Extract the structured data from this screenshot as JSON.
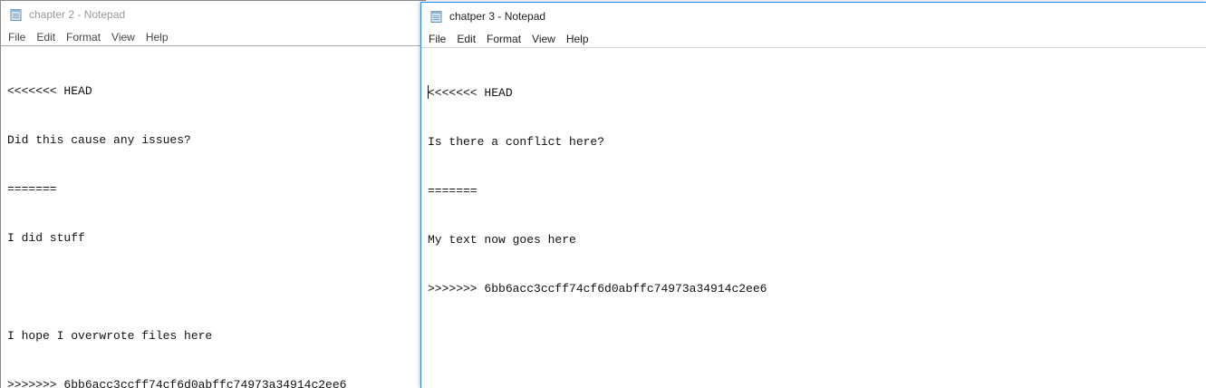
{
  "windows": [
    {
      "title": "chapter 2 - Notepad",
      "active": false,
      "icon": "notepad-icon",
      "menu": [
        "File",
        "Edit",
        "Format",
        "View",
        "Help"
      ],
      "lines": [
        "<<<<<<< HEAD",
        "Did this cause any issues?",
        "=======",
        "I did stuff",
        "",
        "I hope I overwrote files here",
        ">>>>>>> 6bb6acc3ccff74cf6d0abffc74973a34914c2ee6"
      ]
    },
    {
      "title": "chatper 3 - Notepad",
      "active": true,
      "icon": "notepad-icon",
      "menu": [
        "File",
        "Edit",
        "Format",
        "View",
        "Help"
      ],
      "lines": [
        "<<<<<<< HEAD",
        "Is there a conflict here?",
        "=======",
        "My text now goes here",
        ">>>>>>> 6bb6acc3ccff74cf6d0abffc74973a34914c2ee6"
      ]
    }
  ],
  "colors": {
    "active_border": "#2b8ee6",
    "inactive_border": "#8a8a8a",
    "inactive_title": "#9a9a9a"
  }
}
